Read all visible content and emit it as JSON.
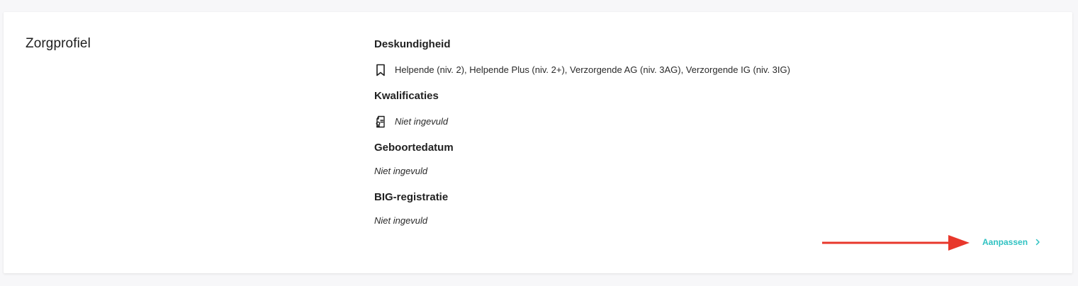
{
  "section": {
    "title": "Zorgprofiel"
  },
  "fields": {
    "deskundigheid": {
      "label": "Deskundigheid",
      "value": "Helpende (niv. 2), Helpende Plus (niv. 2+), Verzorgende AG (niv. 3AG), Verzorgende IG (niv. 3IG)",
      "icon": "bookmark-icon"
    },
    "kwalificaties": {
      "label": "Kwalificaties",
      "value": "Niet ingevuld",
      "icon": "certificate-icon"
    },
    "geboortedatum": {
      "label": "Geboortedatum",
      "value": "Niet ingevuld"
    },
    "big_registratie": {
      "label": "BIG-registratie",
      "value": "Niet ingevuld"
    }
  },
  "actions": {
    "edit_label": "Aanpassen"
  },
  "colors": {
    "accent": "#2fc2c2",
    "annotation_arrow": "#e8372b",
    "text": "#1f1f1f",
    "background": "#f7f7f9",
    "card": "#ffffff"
  }
}
